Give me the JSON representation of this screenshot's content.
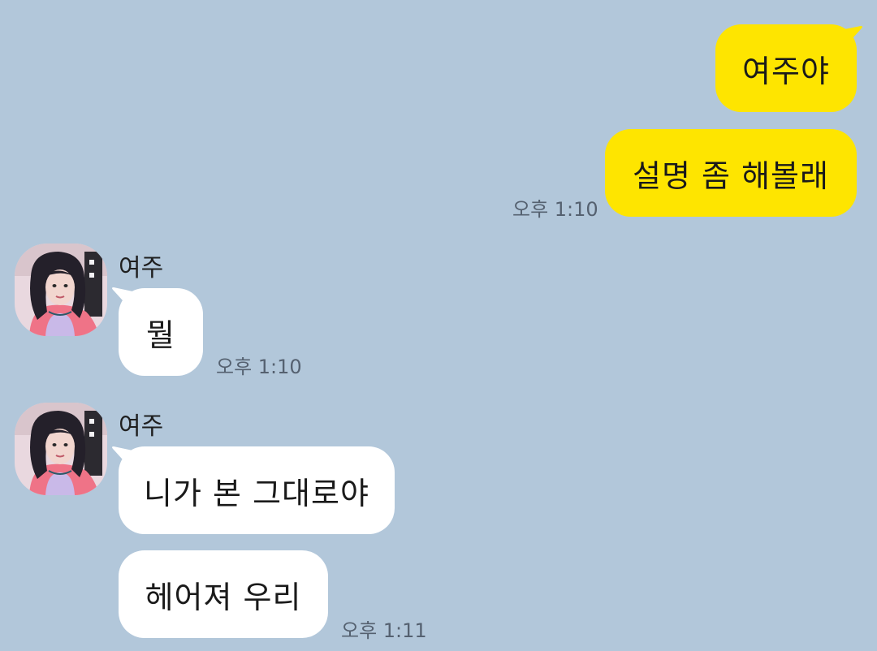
{
  "theme": {
    "background": "#b2c7da",
    "my_bubble_color": "#fee500",
    "their_bubble_color": "#ffffff",
    "time_color": "#556170"
  },
  "messages": {
    "m1": {
      "text": "여주야"
    },
    "m2": {
      "text": "설명 좀 해볼래",
      "time": "오후 1:10"
    },
    "m3": {
      "sender": "여주",
      "text": "뭘",
      "time": "오후 1:10"
    },
    "m4": {
      "sender": "여주",
      "text": "니가 본 그대로야"
    },
    "m5": {
      "text": "헤어져 우리",
      "time": "오후 1:11"
    }
  },
  "icons": {
    "avatar": "profile-photo-avatar"
  }
}
